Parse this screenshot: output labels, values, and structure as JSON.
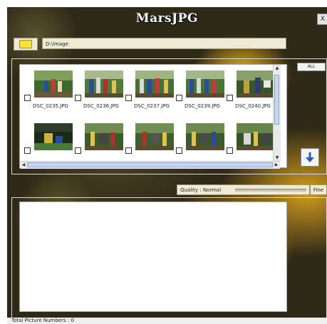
{
  "app": {
    "title": "MarsJPG",
    "close_label": "X"
  },
  "toolbar": {
    "path_value": "D:\\image"
  },
  "thumbnails": {
    "all_label": "ALL",
    "row1": [
      {
        "file": "DSC_0235.JPG"
      },
      {
        "file": "DSC_0236.JPG"
      },
      {
        "file": "DSC_0237.JPG"
      },
      {
        "file": "DSC_0239.JPG"
      },
      {
        "file": "DSC_0240.JPG"
      }
    ],
    "row2": [
      {},
      {},
      {},
      {},
      {}
    ]
  },
  "quality": {
    "label": "Quality : Normal",
    "value": "Fine"
  },
  "status": {
    "text": "Total Picture Numbers : 0"
  },
  "colors": {
    "accent": "#2a58c8",
    "panel": "#efead3",
    "frame": "#d9d9d9"
  }
}
